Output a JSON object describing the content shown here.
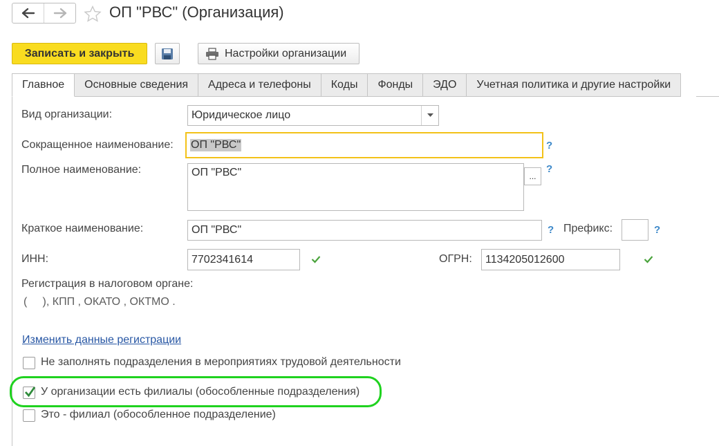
{
  "window": {
    "title": "ОП \"РВС\" (Организация)"
  },
  "nav": {
    "back_icon": "arrow-left-icon",
    "forward_icon": "arrow-right-icon",
    "favorite_icon": "star-icon"
  },
  "toolbar": {
    "save_close_label": "Записать и закрыть",
    "save_icon": "floppy-disk-icon",
    "settings_label": "Настройки организации",
    "settings_icon": "printer-icon"
  },
  "tabs": [
    {
      "label": "Главное",
      "active": true
    },
    {
      "label": "Основные сведения",
      "active": false
    },
    {
      "label": "Адреса и телефоны",
      "active": false
    },
    {
      "label": "Коды",
      "active": false
    },
    {
      "label": "Фонды",
      "active": false
    },
    {
      "label": "ЭДО",
      "active": false
    },
    {
      "label": "Учетная политика и другие настройки",
      "active": false
    }
  ],
  "form": {
    "org_type": {
      "label": "Вид организации:",
      "value": "Юридическое лицо"
    },
    "short_name": {
      "label": "Сокращенное наименование:",
      "value": "ОП \"РВС\""
    },
    "full_name": {
      "label": "Полное наименование:",
      "value": "ОП \"РВС\"",
      "button": "..."
    },
    "brief_name": {
      "label": "Краткое наименование:",
      "value": "ОП \"РВС\""
    },
    "prefix": {
      "label": "Префикс:",
      "value": ""
    },
    "inn": {
      "label": "ИНН:",
      "value": "7702341614"
    },
    "ogrn": {
      "label": "ОГРН:",
      "value": "1134205012600"
    },
    "help": "?",
    "tax_registration": {
      "label": "Регистрация в налоговом органе:",
      "details": "(     ), КПП , ОКАТО , ОКТМО ."
    },
    "change_link": "Изменить данные регистрации",
    "checkboxes": [
      {
        "label": "Не заполнять подразделения в мероприятиях трудовой деятельности",
        "checked": false
      },
      {
        "label": "У организации есть филиалы (обособленные подразделения)",
        "checked": true
      },
      {
        "label": "Это - филиал (обособленное подразделение)",
        "checked": false
      }
    ]
  },
  "colors": {
    "primary_button": "#f9dc20",
    "focus_border": "#f3c218",
    "help_icon": "#3c88c9",
    "valid_check": "#4aa33c",
    "highlight_ring": "#1fd21f",
    "link": "#2857a4"
  }
}
